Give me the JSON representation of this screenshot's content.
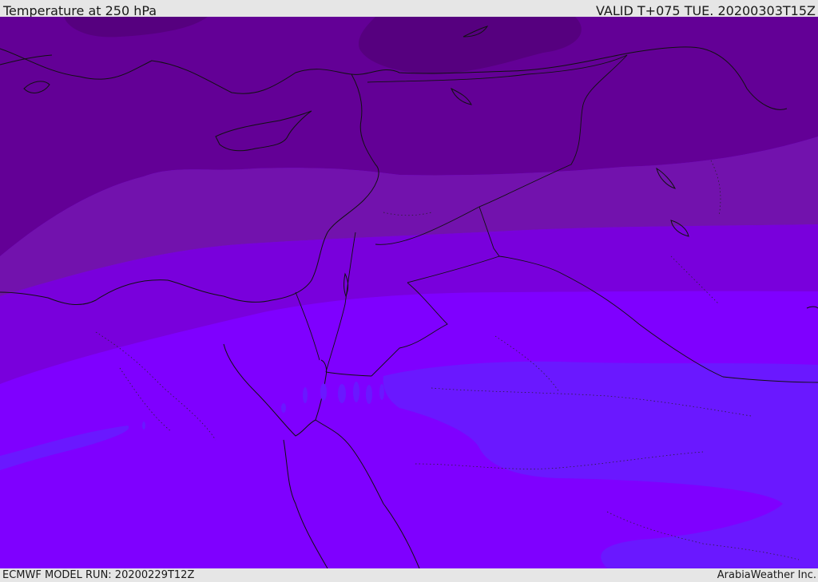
{
  "header": {
    "title": "Temperature at 250 hPa",
    "valid_time": "VALID T+075 TUE. 20200303T15Z"
  },
  "footer": {
    "model_run": "ECMWF MODEL RUN: 20200229T12Z",
    "credit": "ArabiaWeather Inc."
  },
  "map": {
    "field": "temperature",
    "level": "250 hPa",
    "region": "Eastern Mediterranean / Middle East",
    "shading_colors": {
      "coldest_band": "#56007f",
      "very_cold_band": "#630096",
      "cold_band": "#7212ad",
      "mid_band": "#7900dc",
      "warm_band": "#7f00ff",
      "warmest_band": "#6a18ff"
    },
    "overlays": [
      "coastlines",
      "country-borders",
      "internal-boundaries"
    ]
  }
}
